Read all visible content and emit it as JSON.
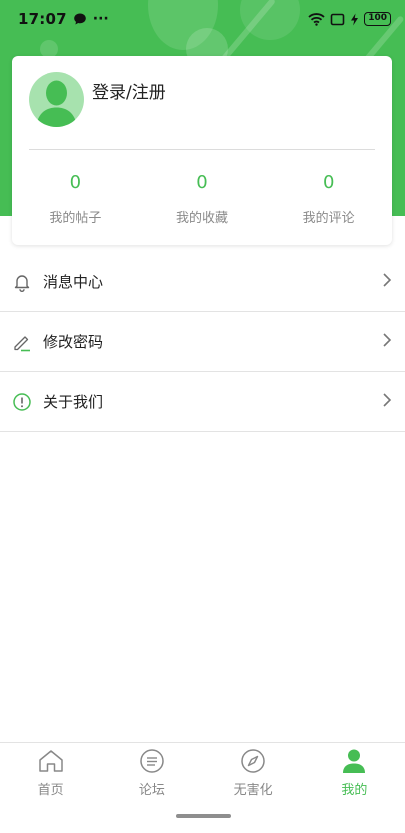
{
  "status_bar": {
    "time": "17:07",
    "more": "···",
    "battery": "100",
    "icons": [
      "chat-bubble-icon",
      "wifi-icon",
      "screen-icon",
      "charging-icon",
      "battery-icon"
    ]
  },
  "profile": {
    "login_label": "登录/注册",
    "stats": [
      {
        "value": "0",
        "label": "我的帖子"
      },
      {
        "value": "0",
        "label": "我的收藏"
      },
      {
        "value": "0",
        "label": "我的评论"
      }
    ]
  },
  "menu": {
    "items": [
      {
        "label": "消息中心",
        "icon": "bell-icon"
      },
      {
        "label": "修改密码",
        "icon": "pencil-icon"
      },
      {
        "label": "关于我们",
        "icon": "info-icon"
      }
    ]
  },
  "tabbar": {
    "tabs": [
      {
        "label": "首页",
        "icon": "home-icon",
        "active": false
      },
      {
        "label": "论坛",
        "icon": "forum-icon",
        "active": false
      },
      {
        "label": "无害化",
        "icon": "compass-icon",
        "active": false
      },
      {
        "label": "我的",
        "icon": "person-icon",
        "active": true
      }
    ]
  },
  "colors": {
    "brand": "#46bd54",
    "avatar_bg": "#a7e2ae",
    "text_secondary": "#8a8a8a"
  }
}
